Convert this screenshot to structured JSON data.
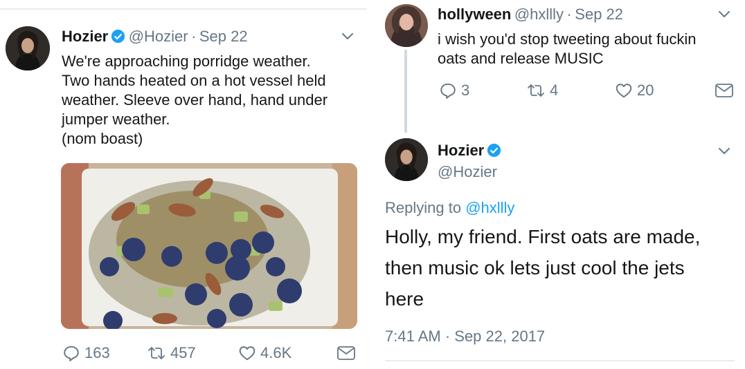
{
  "left_tweet": {
    "name": "Hozier",
    "handle": "@Hozier",
    "separator": "·",
    "date": "Sep 22",
    "text": "We're approaching porridge weather.\nTwo hands heated on a hot vessel held\nweather. Sleeve over hand, hand under\njumper weather.\n (nom boast)",
    "replies": "163",
    "retweets": "457",
    "likes": "4.6K"
  },
  "reply_tweet": {
    "name": "hollyween",
    "handle": "@hxllly",
    "separator": "·",
    "date": "Sep 22",
    "text": "i wish you'd stop tweeting about fuckin\noats and release MUSIC",
    "replies": "3",
    "retweets": "4",
    "likes": "20"
  },
  "main_tweet": {
    "name": "Hozier",
    "handle": "@Hozier",
    "replying_prefix": "Replying to",
    "replying_handle": "@hxllly",
    "text": "Holly, my friend. First oats are made,\nthen music ok lets just cool the jets\nhere",
    "timestamp": "7:41 AM · Sep 22, 2017"
  },
  "icons": [
    "verified-badge-icon",
    "chevron-down-icon",
    "reply-icon",
    "retweet-icon",
    "like-icon",
    "message-icon"
  ],
  "colors": {
    "link": "#1da1f2",
    "muted": "#657786",
    "text": "#14171a",
    "divider": "#e6ecf0"
  }
}
